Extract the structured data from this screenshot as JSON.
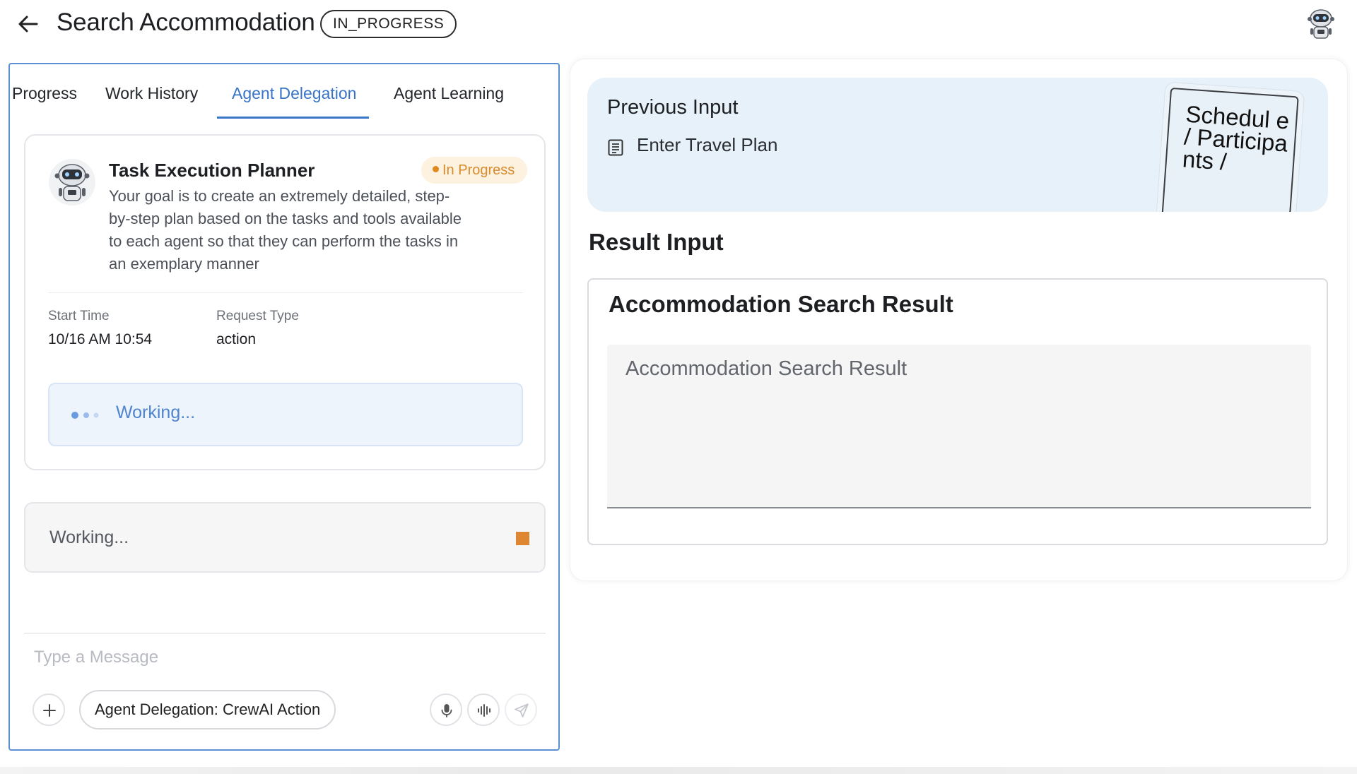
{
  "header": {
    "title": "Search Accommodation",
    "status": "IN_PROGRESS"
  },
  "tabs": [
    {
      "label": "Progress"
    },
    {
      "label": "Work History"
    },
    {
      "label": "Agent Delegation",
      "active": true
    },
    {
      "label": "Agent Learning"
    }
  ],
  "agent": {
    "name": "Task Execution Planner",
    "badge": "In Progress",
    "description": "Your goal is to create an extremely detailed, step-by-step plan based on the tasks and tools available to each agent so that they can perform the tasks in an exemplary manner",
    "start_time_label": "Start Time",
    "start_time": "10/16 AM 10:54",
    "request_type_label": "Request Type",
    "request_type": "action",
    "working_text": "Working..."
  },
  "status_box": {
    "text": "Working..."
  },
  "composer": {
    "placeholder": "Type a Message",
    "mode_chip": "Agent Delegation: CrewAI Action"
  },
  "previous_input": {
    "title": "Previous Input",
    "item": "Enter Travel Plan",
    "note_text": "Schedul e / Participa nts /"
  },
  "result": {
    "heading": "Result Input",
    "card_title": "Accommodation Search Result",
    "field_label": "Accommodation Search Result"
  },
  "colors": {
    "accent": "#3874c8",
    "in_progress": "#df8633",
    "working_bg": "#eef4fc",
    "previous_bg": "#e6f1f9"
  },
  "icons": [
    "arrow-left-icon",
    "robot-avatar-icon",
    "document-icon",
    "plus-icon",
    "microphone-icon",
    "audio-wave-icon",
    "send-icon",
    "stop-icon"
  ]
}
